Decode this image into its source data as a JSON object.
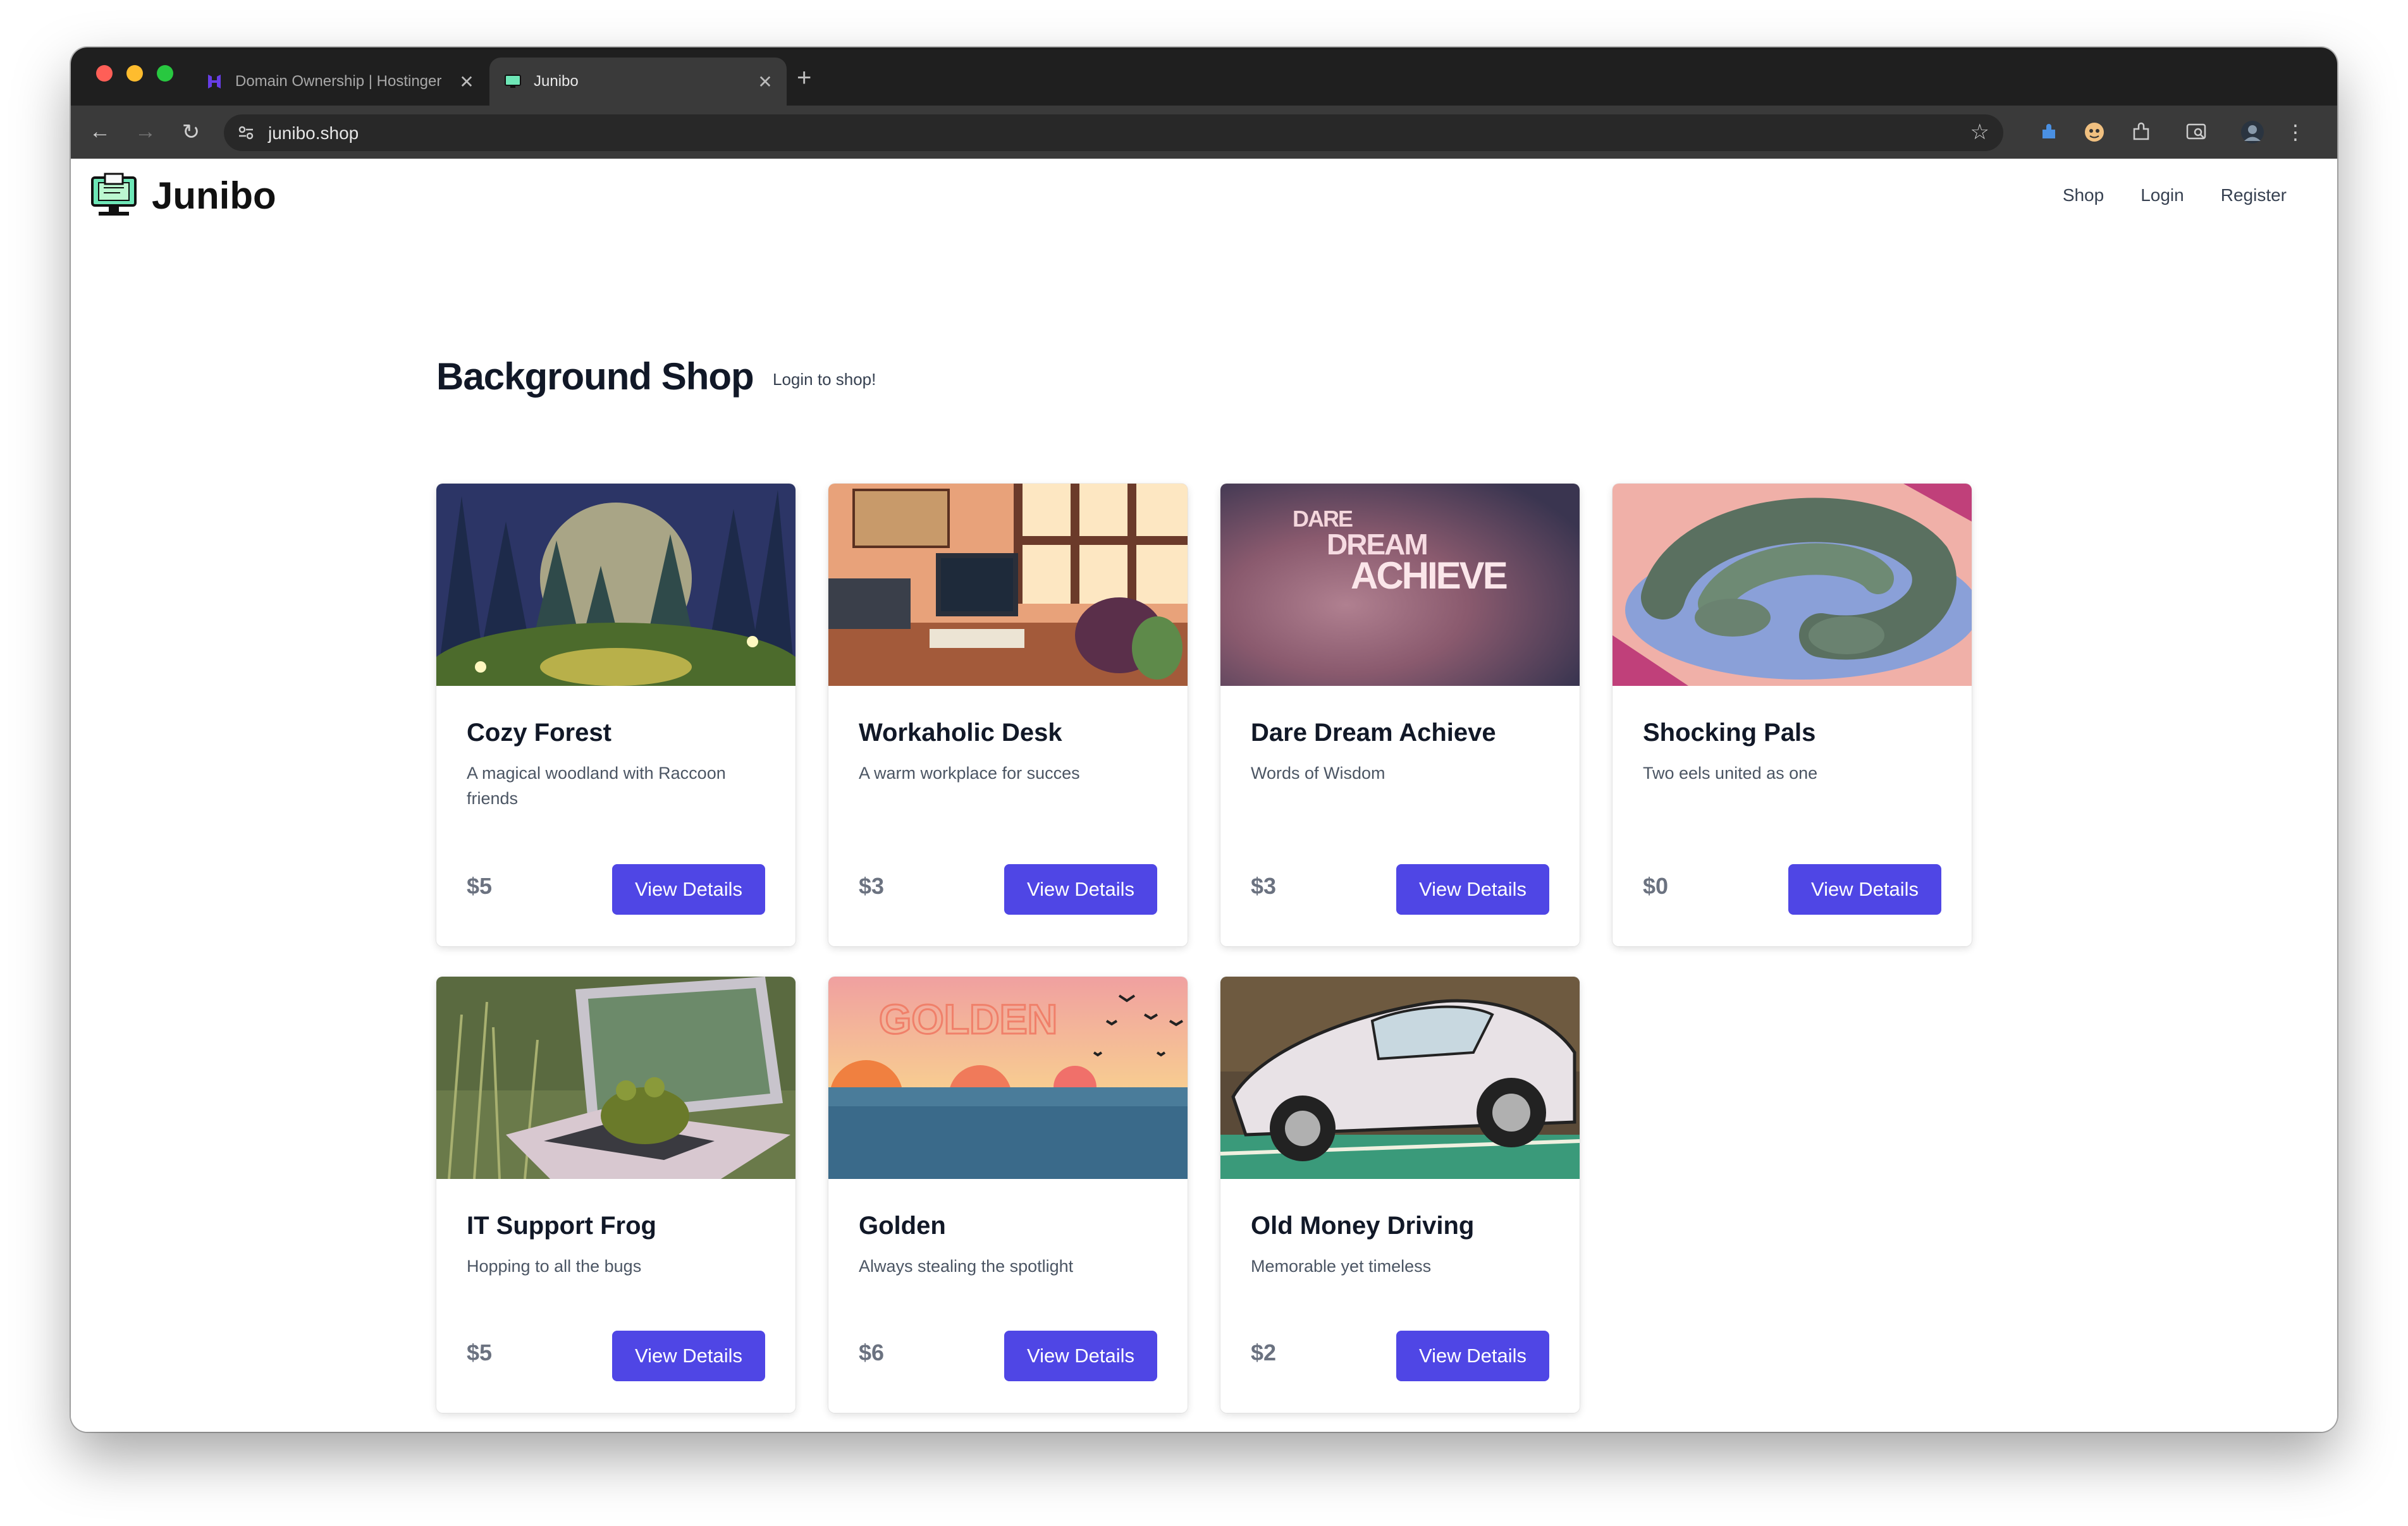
{
  "browser": {
    "tabs": [
      {
        "title": "Domain Ownership | Hostinger"
      },
      {
        "title": "Junibo"
      }
    ],
    "url": "junibo.shop"
  },
  "site": {
    "name": "Junibo",
    "nav": [
      "Shop",
      "Login",
      "Register"
    ]
  },
  "main": {
    "heading": "Background Shop",
    "subheading": "Login to shop!",
    "button_label": "View Details",
    "products": [
      {
        "title": "Cozy Forest",
        "description": "A magical woodland with Raccoon friends",
        "price": "$5"
      },
      {
        "title": "Workaholic Desk",
        "description": "A warm workplace for succes",
        "price": "$3"
      },
      {
        "title": "Dare Dream Achieve",
        "description": "Words of Wisdom",
        "price": "$3",
        "image_text": [
          "DARE",
          "DREAM",
          "ACHIEVE"
        ]
      },
      {
        "title": "Shocking Pals",
        "description": "Two eels united as one",
        "price": "$0"
      },
      {
        "title": "IT Support Frog",
        "description": "Hopping to all the bugs",
        "price": "$5"
      },
      {
        "title": "Golden",
        "description": "Always stealing the spotlight",
        "price": "$6",
        "image_text": "GOLDEN"
      },
      {
        "title": "Old Money Driving",
        "description": "Memorable yet timeless",
        "price": "$2"
      }
    ]
  },
  "colors": {
    "accent": "#4f46e5",
    "chrome_dark": "#1f1f1f",
    "chrome_toolbar": "#3a3a3a"
  }
}
